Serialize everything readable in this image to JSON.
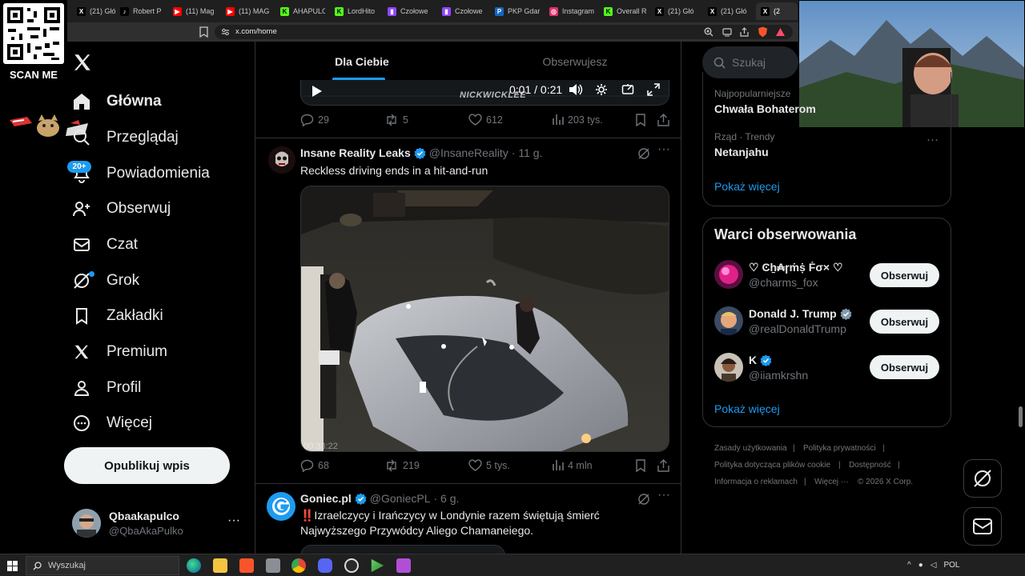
{
  "browser": {
    "url": "x.com/home",
    "tabs": [
      {
        "title": "(21) Głó",
        "icon": "x-icon"
      },
      {
        "title": "Robert P",
        "icon": "tiktok-icon"
      },
      {
        "title": "(11) Mag",
        "icon": "youtube-icon"
      },
      {
        "title": "(11) MAG",
        "icon": "youtube-icon"
      },
      {
        "title": "AHAPULC",
        "icon": "kick-icon"
      },
      {
        "title": "LordHito",
        "icon": "kick-icon"
      },
      {
        "title": "Czołowe",
        "icon": "twitch-icon"
      },
      {
        "title": "Czołowe",
        "icon": "twitch-icon"
      },
      {
        "title": "PKP Gdań",
        "icon": "pkp-icon"
      },
      {
        "title": "Instagram",
        "icon": "instagram-icon"
      },
      {
        "title": "Overall R",
        "icon": "kick-icon"
      },
      {
        "title": "(21) Głó",
        "icon": "x-icon"
      },
      {
        "title": "(21) Głó",
        "icon": "x-icon"
      },
      {
        "title": "(2",
        "icon": "x-icon"
      }
    ]
  },
  "overlay": {
    "qr_label": "SCAN ME"
  },
  "nav": {
    "items": [
      {
        "label": "Główna",
        "icon": "home-icon",
        "active": true
      },
      {
        "label": "Przeglądaj",
        "icon": "explore-icon"
      },
      {
        "label": "Powiadomienia",
        "icon": "bell-icon",
        "badge": "20+"
      },
      {
        "label": "Obserwuj",
        "icon": "follow-icon"
      },
      {
        "label": "Czat",
        "icon": "mail-icon"
      },
      {
        "label": "Grok",
        "icon": "grok-icon"
      },
      {
        "label": "Zakładki",
        "icon": "bookmark-icon"
      },
      {
        "label": "Premium",
        "icon": "x-logo-icon"
      },
      {
        "label": "Profil",
        "icon": "profile-icon"
      },
      {
        "label": "Więcej",
        "icon": "more-circle-icon"
      }
    ],
    "post_label": "Opublikuj wpis",
    "account": {
      "name": "Qbaakapulco",
      "handle": "@QbaAkaPulko",
      "more": "···"
    }
  },
  "feed": {
    "tabs": [
      "Dla Ciebie",
      "Obserwujesz"
    ],
    "video_time": "0:01 / 0:21",
    "watermark": "NICKWICKLEE",
    "first_actions": {
      "replies": "29",
      "reposts": "5",
      "likes": "612",
      "views": "203 tys."
    },
    "tweets": [
      {
        "author": "Insane Reality Leaks",
        "handle": "@InsaneReality",
        "time": "· 11 g.",
        "text": "Reckless driving ends in a hit-and-run",
        "timestamp_overlay": "00:33:22",
        "replies": "68",
        "reposts": "219",
        "likes": "5 tys.",
        "views": "4 mln"
      },
      {
        "author": "Goniec.pl",
        "handle": "@GoniecPL",
        "time": "· 6 g.",
        "text": "‼️Izraelczycy i Irańczycy w Londynie razem świętują śmierć Najwyższego Przywódcy Aliego Chamaneiego."
      }
    ]
  },
  "sidebar": {
    "search_placeholder": "Szukaj",
    "trends": [
      {
        "category": "Najpopularniejsze",
        "name": "Chwała Bohaterom"
      },
      {
        "category": "Rząd · Trendy",
        "name": "Netanjahu"
      }
    ],
    "trends_more": "Pokaż więcej",
    "who_to_follow": {
      "title": "Warci obserwowania",
      "follow_label": "Obserwuj",
      "more": "Pokaż więcej",
      "users": [
        {
          "name": "♡ Ͼẖ₳ɼṁṩ Ḟσ× ♡",
          "handle": "@charms_fox",
          "verified": false
        },
        {
          "name": "Donald J. Trump",
          "handle": "@realDonaldTrump",
          "verified": true
        },
        {
          "name": "K",
          "handle": "@iiamkrshn",
          "verified": true
        }
      ]
    },
    "footer": [
      "Zasady użytkowania",
      "|",
      "Polityka prywatności",
      "|",
      "Polityka dotycząca plików cookie",
      "|",
      "Dostępność",
      "|",
      "Informacja o reklamach",
      "|",
      "Więcej ···",
      "© 2026 X Corp."
    ]
  },
  "taskbar": {
    "search_label": "Wyszukaj",
    "lang": "POL"
  },
  "colors": {
    "accent": "#1d9bf0",
    "bg": "#000000",
    "border": "#2f3336",
    "muted": "#71767b"
  }
}
